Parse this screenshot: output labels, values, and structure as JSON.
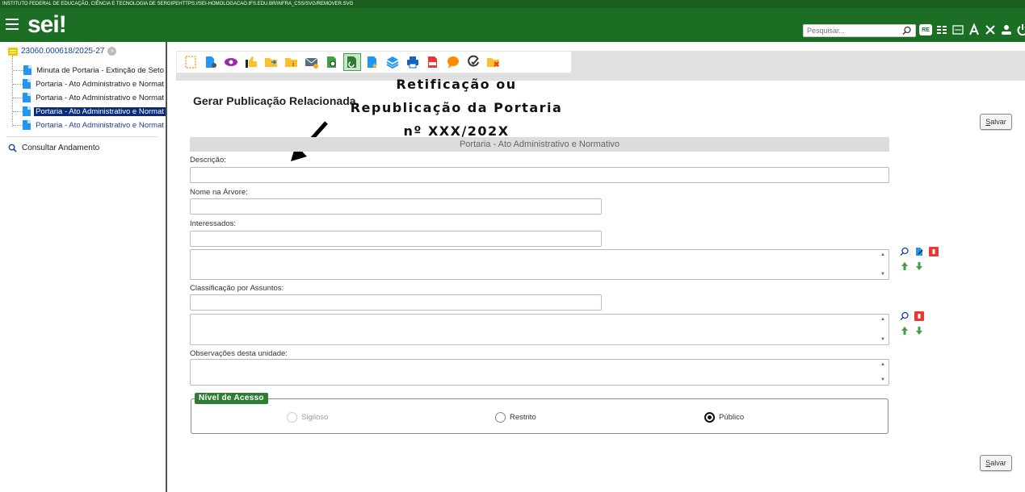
{
  "topbar": {
    "text": "INSTITUTO FEDERAL DE EDUCAÇÃO, CIÊNCIA E TECNOLOGIA DE SERGIPEHTTPS://SEI-HOMOLOGACAO.IFS.EDU.BR/INFRA_CSS/SVG/REMOVER.SVG"
  },
  "header": {
    "logo": "sei",
    "logo_mark": "!",
    "search_placeholder": "Pesquisar...",
    "re_badge": "RE",
    "icons": [
      "search-icon",
      "re-badge",
      "grid-icon",
      "keypad-icon",
      "font-size-icon",
      "tools-icon",
      "user-icon",
      "power-icon"
    ]
  },
  "sidebar": {
    "process_number": "23060.000618/2025-27",
    "documents": [
      {
        "label": "Minuta de Portaria - Extinção de Seto",
        "state": "normal"
      },
      {
        "label": "Portaria - Ato Administrativo e Normat",
        "state": "normal"
      },
      {
        "label": "Portaria - Ato Administrativo e Normat",
        "state": "normal"
      },
      {
        "label": "Portaria - Ato Administrativo e Normat",
        "state": "selected"
      },
      {
        "label": "Portaria - Ato Administrativo e Normat",
        "state": "link"
      }
    ],
    "consult_label": "Consultar Andamento"
  },
  "page": {
    "title": "Gerar Publicação Relacionada",
    "overlay_line1": "Retificação ou",
    "overlay_line2": "Republicação da Portaria",
    "overlay_line3": "nº XXX/202X",
    "section_title": "Portaria - Ato Administrativo e Normativo",
    "save_label_pre": "",
    "save_label_u": "S",
    "save_label_post": "alvar"
  },
  "form": {
    "descricao_label": "Descrição:",
    "nome_arvore_label": "Nome na Árvore:",
    "interessados_label": "Interessados:",
    "classificacao_label": "Classificação por Assuntos:",
    "observacoes_label": "Observações desta unidade:",
    "nivel_acesso_legend": "Nível de Acesso",
    "radios": [
      {
        "label": "Sigiloso",
        "state": "disabled"
      },
      {
        "label": "Restrito",
        "state": "unchecked"
      },
      {
        "label": "Público",
        "state": "checked"
      }
    ]
  },
  "colors": {
    "header_green": "#1b6e23",
    "legend_green": "#2e7d32",
    "selected_navy": "#0a2a7a"
  }
}
